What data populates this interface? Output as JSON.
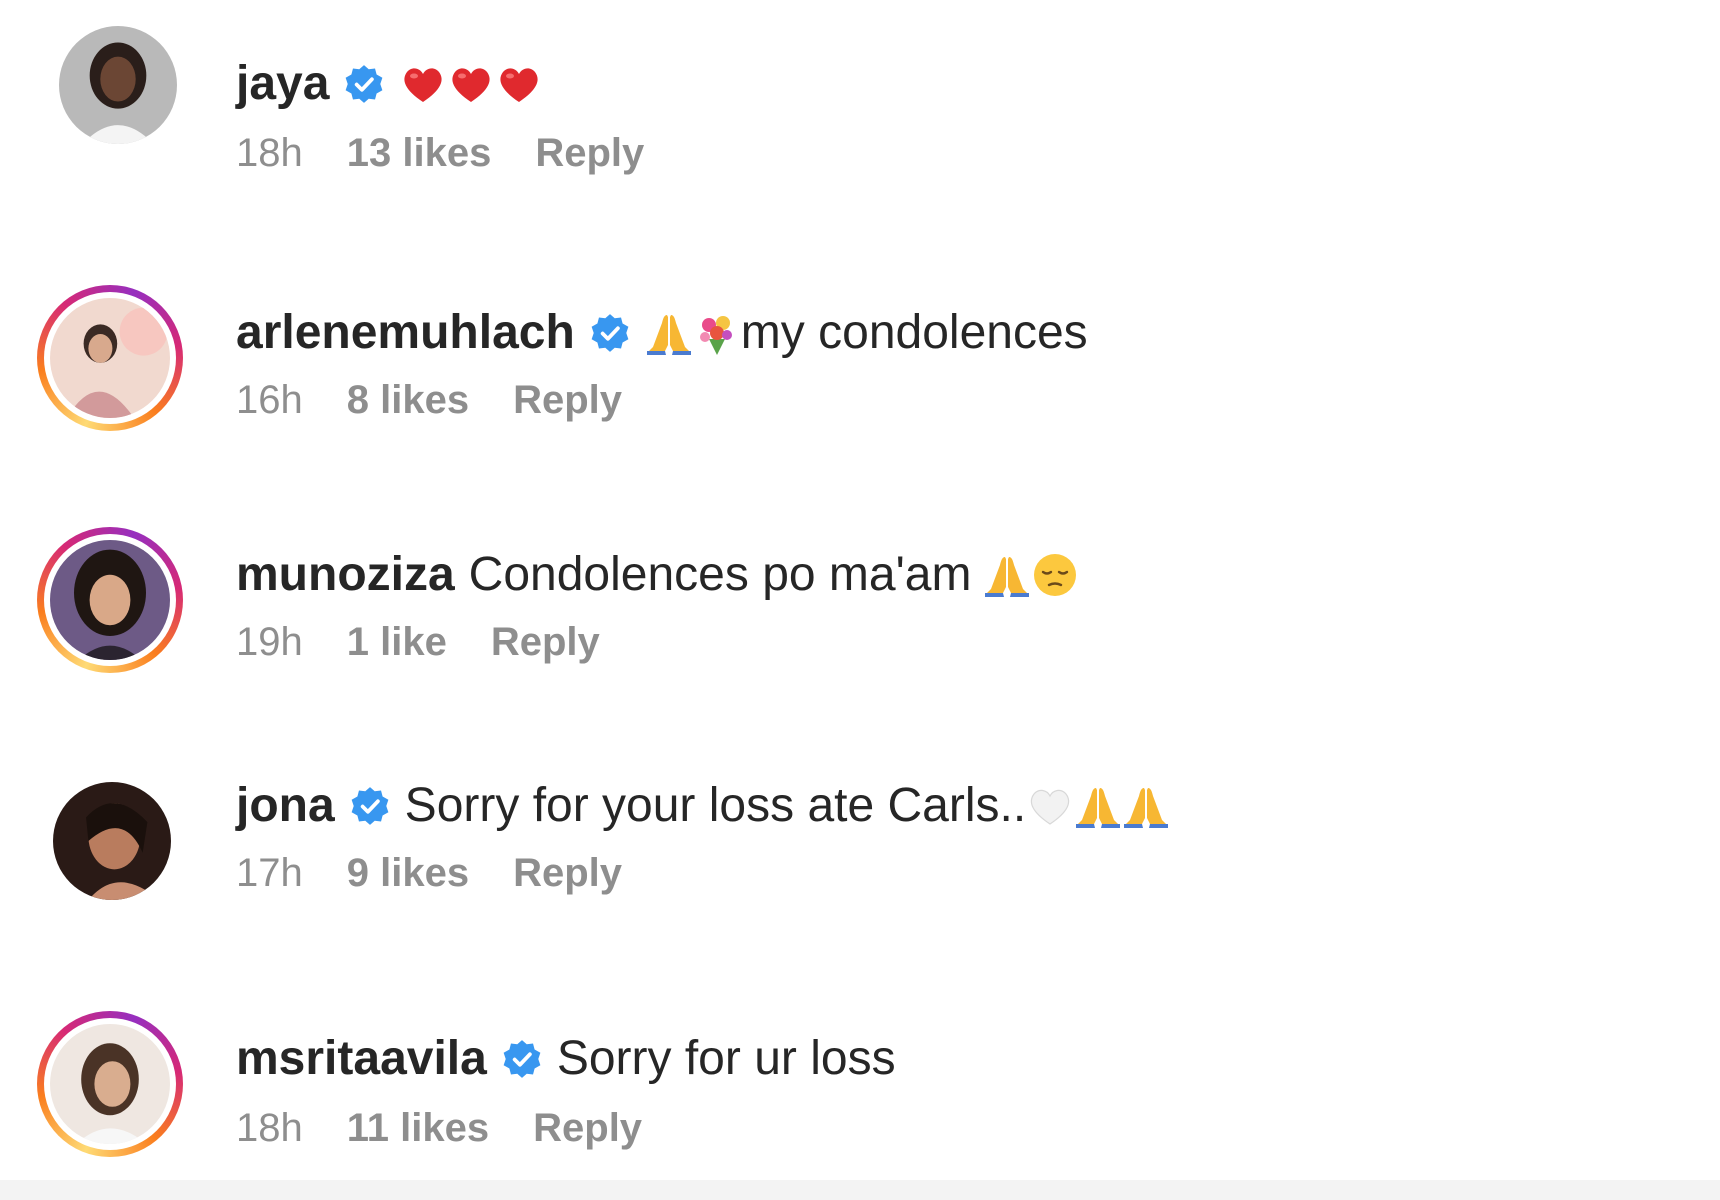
{
  "comments": [
    {
      "username": "jaya",
      "verified": true,
      "text": "",
      "emojis": [
        "red-heart",
        "red-heart",
        "red-heart"
      ],
      "time": "18h",
      "likes": "13 likes",
      "reply": "Reply",
      "story_ring": false
    },
    {
      "username": "arlenemuhlach",
      "verified": true,
      "text": "my condolences",
      "emojis_before_text": [
        "folded-hands",
        "bouquet"
      ],
      "time": "16h",
      "likes": "8 likes",
      "reply": "Reply",
      "story_ring": true
    },
    {
      "username": "munoziza",
      "verified": false,
      "text": "Condolences po ma'am",
      "emojis": [
        "folded-hands",
        "pensive-face"
      ],
      "time": "19h",
      "likes": "1 like",
      "reply": "Reply",
      "story_ring": true
    },
    {
      "username": "jona",
      "verified": true,
      "text": "Sorry for your loss ate Carls..",
      "emojis": [
        "white-heart",
        "folded-hands",
        "folded-hands"
      ],
      "time": "17h",
      "likes": "9 likes",
      "reply": "Reply",
      "story_ring": false
    },
    {
      "username": "msritaavila",
      "verified": true,
      "text": "Sorry for ur loss",
      "emojis": [],
      "time": "18h",
      "likes": "11 likes",
      "reply": "Reply",
      "story_ring": true
    }
  ],
  "colors": {
    "text": "#262626",
    "meta": "#8e8e8e",
    "verified": "#3897f0"
  }
}
